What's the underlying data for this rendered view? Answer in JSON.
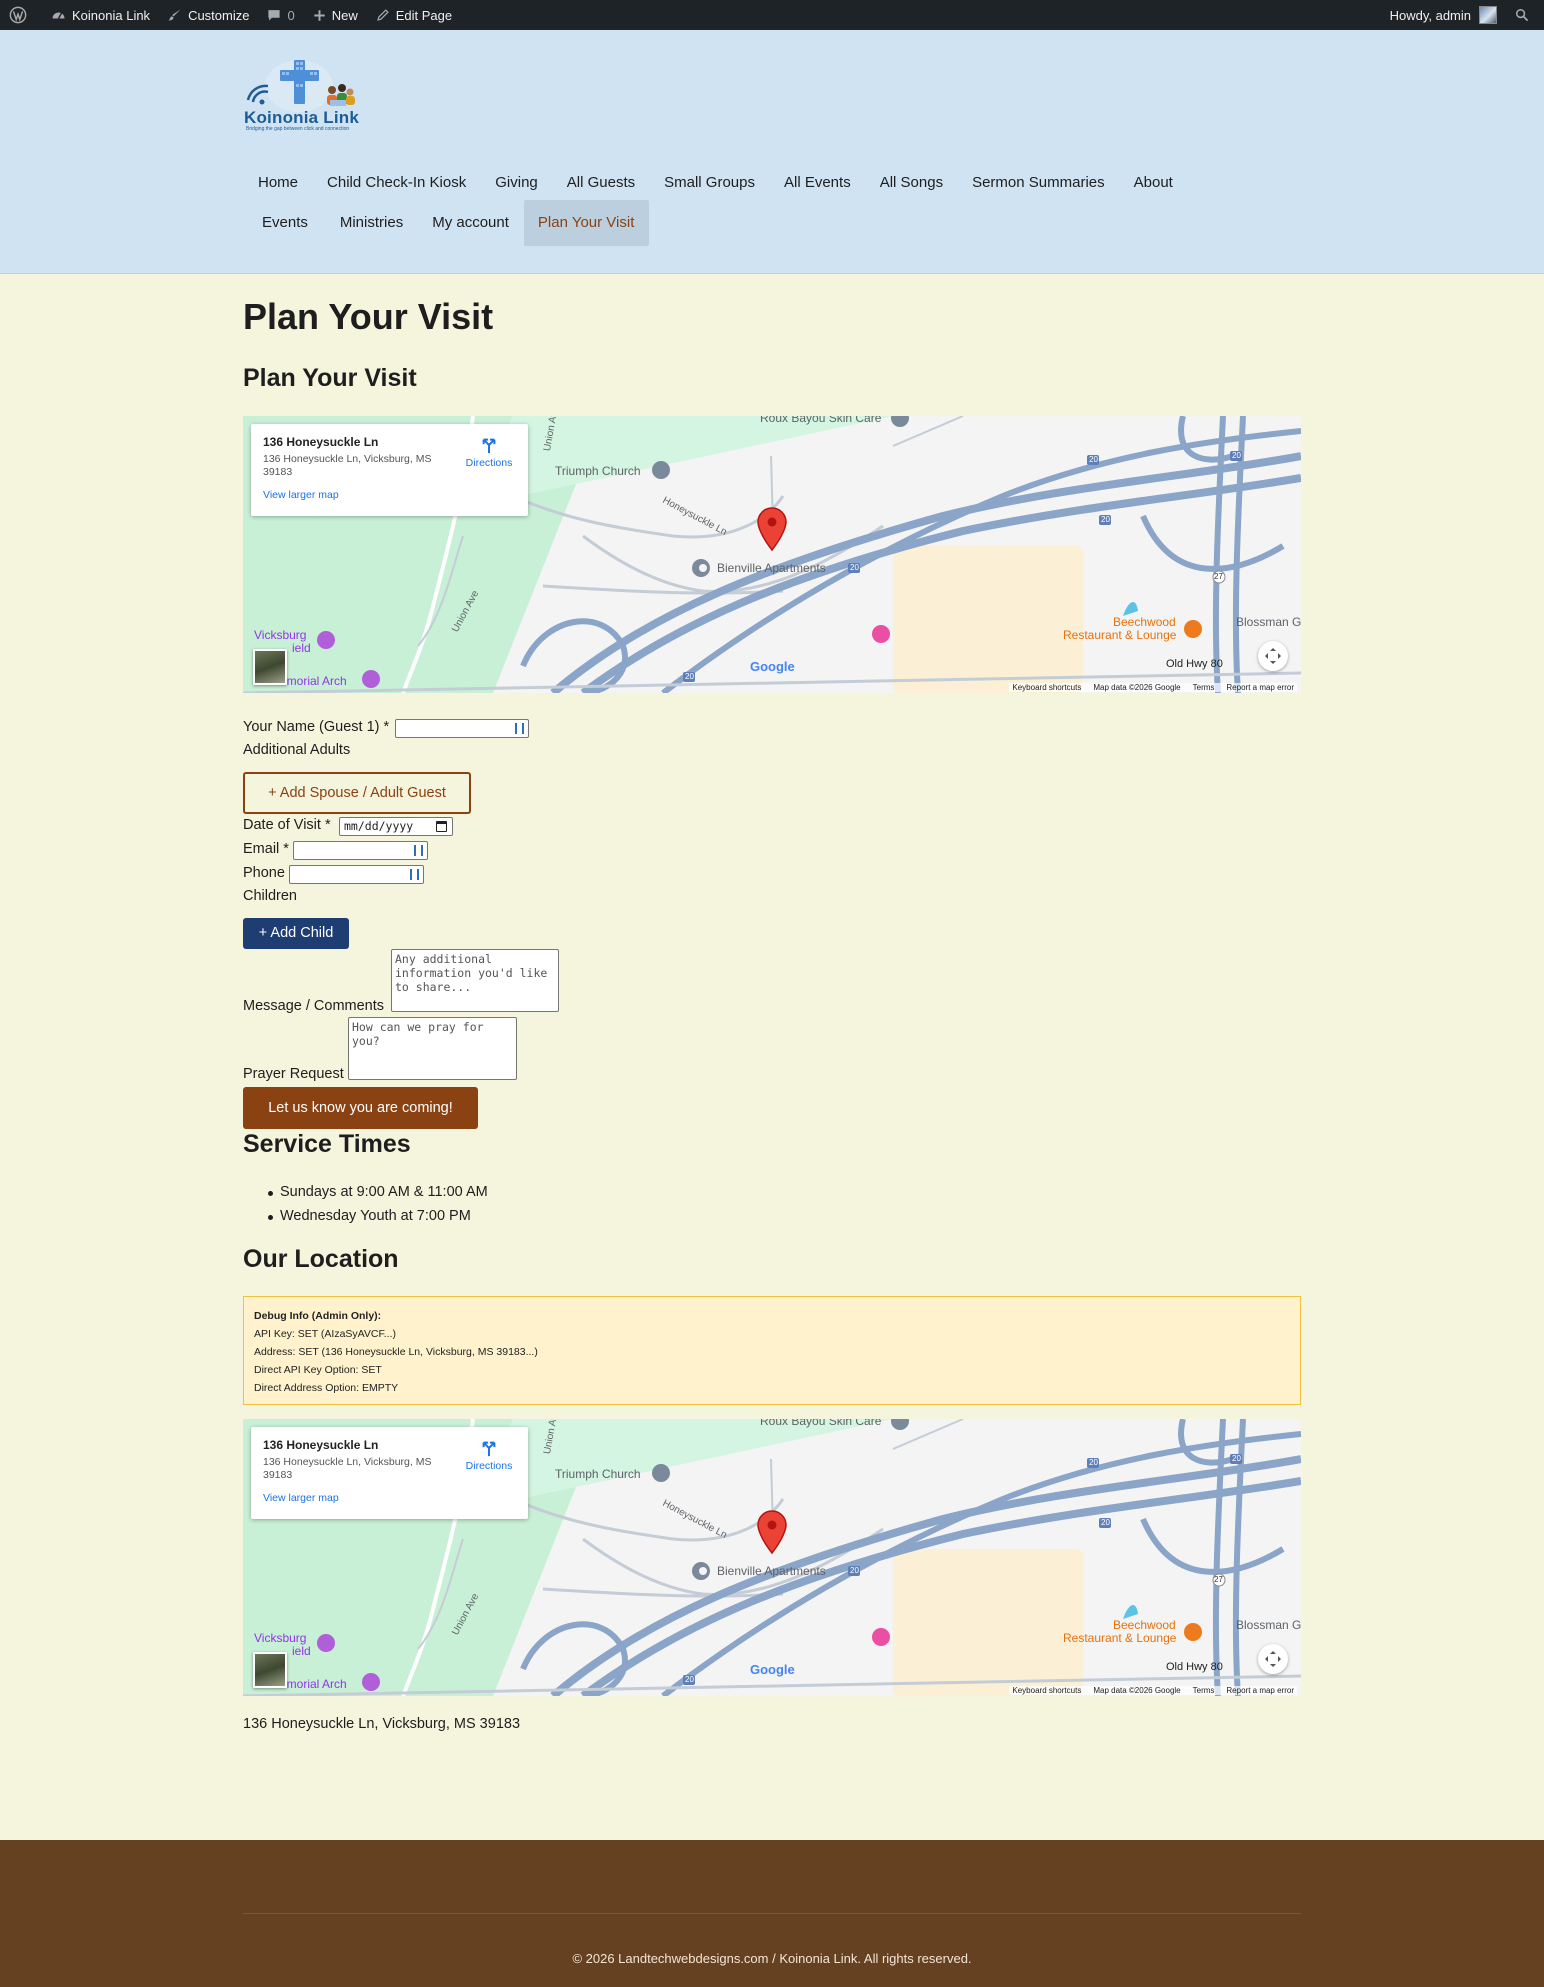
{
  "admin_bar": {
    "site_name": "Koinonia Link",
    "customize": "Customize",
    "comments_count": "0",
    "new": "New",
    "edit_page": "Edit Page",
    "howdy": "Howdy, admin"
  },
  "header": {
    "logo_text": "Koinonia Link",
    "logo_tagline": "Bridging the gap between click and connection",
    "nav_row1": [
      "Home",
      "Child Check-In Kiosk",
      "Giving",
      "All Guests",
      "Small Groups",
      "All Events",
      "All Songs",
      "Sermon Summaries",
      "About"
    ],
    "nav_row2": [
      "Events",
      "Ministries",
      "My account",
      "Plan Your Visit"
    ],
    "active_item": "Plan Your Visit"
  },
  "page": {
    "title": "Plan Your Visit",
    "subtitle": "Plan Your Visit"
  },
  "map": {
    "card_title": "136 Honeysuckle Ln",
    "card_address": "136 Honeysuckle Ln, Vicksburg, MS 39183",
    "directions": "Directions",
    "view_larger": "View larger map",
    "labels": {
      "roux": "Roux Bayou Skin Care",
      "triumph": "Triumph Church",
      "honeysuckle": "Honeysuckle Ln",
      "bienville": "Bienville Apartments",
      "union_ave": "Union Ave",
      "union_ave_top": "Union Av",
      "vicksburg": "Vicksburg",
      "field": "ield",
      "memorial": "Memorial Arch",
      "beechwood1": "Beechwood",
      "beechwood2": "Restaurant & Lounge",
      "blossman": "Blossman G",
      "old_hwy": "Old Hwy 80",
      "google": "Google",
      "i20": "20",
      "r27": "27"
    },
    "footer": [
      "Keyboard shortcuts",
      "Map data ©2026 Google",
      "Terms",
      "Report a map error"
    ]
  },
  "form": {
    "name_label": "Your Name (Guest 1) *",
    "additional_adults": "Additional Adults",
    "add_spouse_button": "+ Add Spouse / Adult Guest",
    "date_label": "Date of Visit *",
    "date_placeholder": "mm/dd/yyyy",
    "email_label": "Email *",
    "phone_label": "Phone",
    "children_label": "Children",
    "add_child_button": "+ Add Child",
    "message_label": "Message / Comments",
    "message_placeholder": "Any additional information you'd like to share...",
    "prayer_label": "Prayer Request",
    "prayer_placeholder": "How can we pray for you?",
    "submit_button": "Let us know you are coming!"
  },
  "service_times": {
    "heading": "Service Times",
    "items": [
      "Sundays at 9:00 AM & 11:00 AM",
      "Wednesday Youth at 7:00 PM"
    ]
  },
  "location": {
    "heading": "Our Location",
    "debug_title": "Debug Info (Admin Only):",
    "debug_lines": [
      "API Key: SET (AIzaSyAVCF...)",
      "Address: SET (136 Honeysuckle Ln, Vicksburg, MS 39183...)",
      "Direct API Key Option: SET",
      "Direct Address Option: EMPTY"
    ],
    "address": "136 Honeysuckle Ln, Vicksburg, MS 39183"
  },
  "footer": {
    "copyright": "© 2026 Landtechwebdesigns.com / Koinonia Link. All rights reserved."
  },
  "colors": {
    "accent_brown": "#8a4213",
    "button_blue": "#1d3d73",
    "header_bg": "#cfe3f2",
    "page_bg": "#f5f4dc",
    "footer_bg": "#654122"
  }
}
